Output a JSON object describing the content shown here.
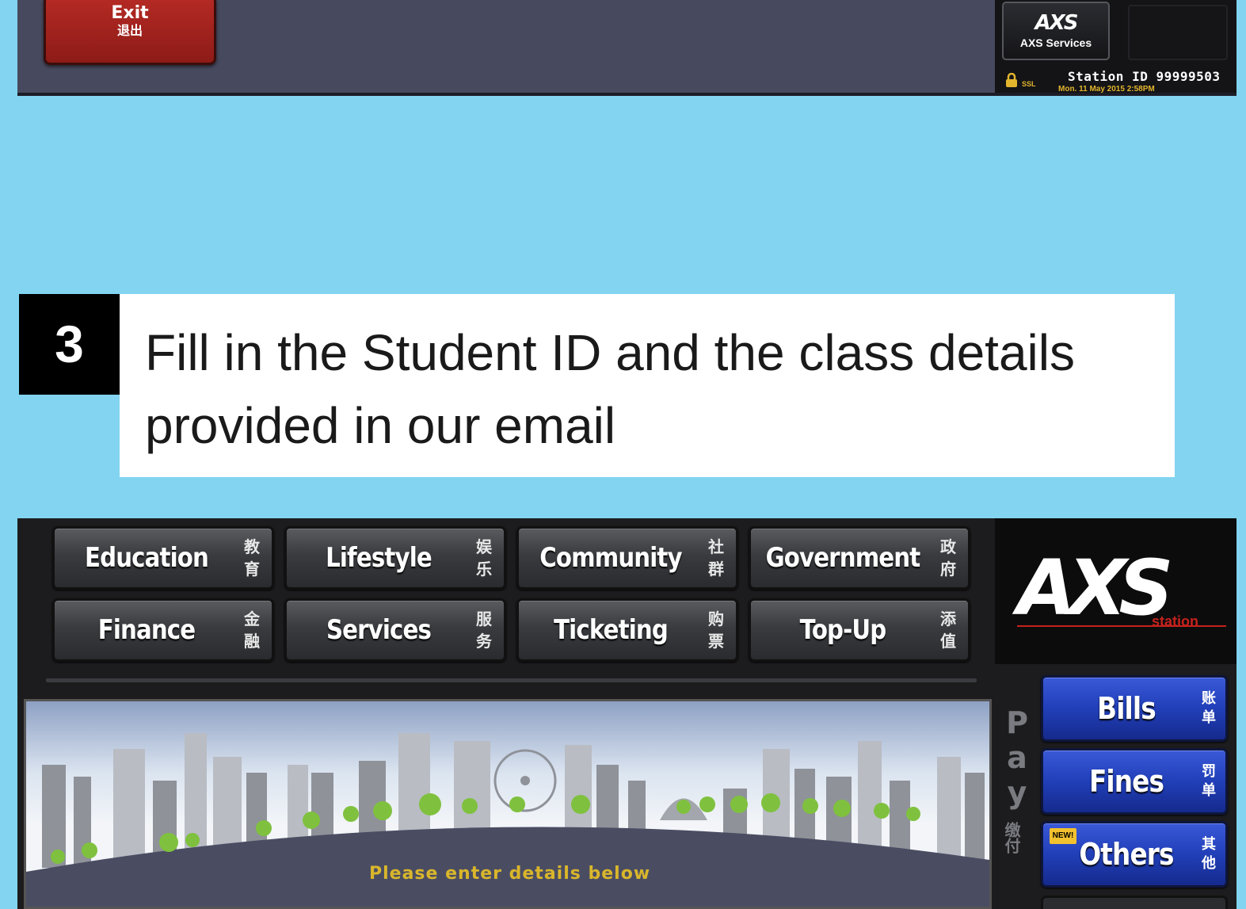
{
  "top_screen": {
    "exit_button": {
      "label": "Exit",
      "label_zh": "退出"
    },
    "axs_services_button": {
      "logo": "AXS",
      "label": "AXS Services"
    },
    "ssl_label": "SSL",
    "station_id": "Station ID 99999503",
    "datetime": "Mon. 11 May 2015  2:58PM"
  },
  "step": {
    "number": "3",
    "text": "Fill in the Student ID and the class details provided in our email"
  },
  "bottom_screen": {
    "categories": [
      {
        "label": "Education",
        "label_zh": "教育"
      },
      {
        "label": "Lifestyle",
        "label_zh": "娱乐"
      },
      {
        "label": "Community",
        "label_zh": "社群"
      },
      {
        "label": "Government",
        "label_zh": "政府"
      },
      {
        "label": "Finance",
        "label_zh": "金融"
      },
      {
        "label": "Services",
        "label_zh": "服务"
      },
      {
        "label": "Ticketing",
        "label_zh": "购票"
      },
      {
        "label": "Top-Up",
        "label_zh": "添值"
      }
    ],
    "logo": {
      "text": "AXS",
      "sub": "station"
    },
    "pay": {
      "word": "Pay",
      "label_zh": "缴付"
    },
    "pay_buttons": [
      {
        "label": "Bills",
        "label_zh": "账单"
      },
      {
        "label": "Fines",
        "label_zh": "罚单"
      },
      {
        "label": "Others",
        "label_zh": "其他",
        "badge": "NEW!"
      }
    ],
    "instruction": "Please enter details below"
  }
}
